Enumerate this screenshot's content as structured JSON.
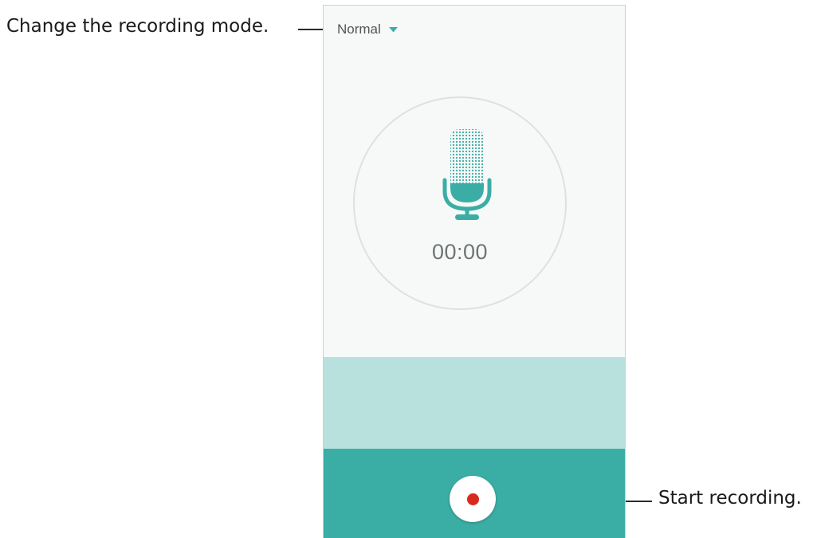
{
  "callouts": {
    "mode": "Change the recording mode.",
    "record": "Start recording."
  },
  "recorder": {
    "mode_label": "Normal",
    "timer": "00:00"
  },
  "icons": {
    "mode_dropdown": "caret-down-icon",
    "mic": "microphone-icon",
    "record": "record-dot-icon"
  },
  "colors": {
    "accent": "#3aaea5",
    "wave_area": "#b8e0dc",
    "record_dot": "#d8291f",
    "background": "#f7f8f8"
  }
}
